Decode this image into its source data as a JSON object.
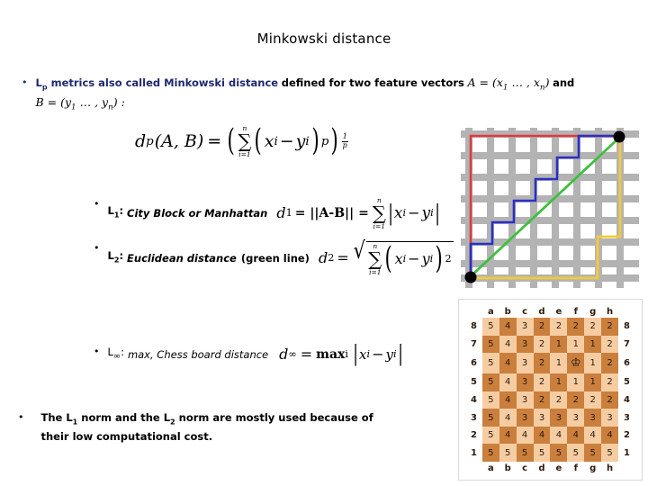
{
  "slide": {
    "title": "Minkowski distance"
  },
  "bullets": {
    "intro": {
      "marker": "•",
      "highlight": "L",
      "highlight_sub": "p",
      "highlight_rest": " metrics also called Minkowski distance",
      "plain": "defined for two feature vectors",
      "vector_a": "A = (x",
      "vector_a_sub1": "1",
      "vector_a_mid": " … , x",
      "vector_a_sub2": "n",
      "vector_a_end": ")",
      "and": "and",
      "vector_b": "B = (y",
      "vector_b_sub1": "1",
      "vector_b_mid": " … , y",
      "vector_b_sub2": "n",
      "vector_b_end": ") :"
    },
    "l1": {
      "marker": "•",
      "name": "L",
      "name_sub": "1",
      "colon": ":",
      "desc": "City Block or Manhattan",
      "d": "d",
      "d_sub": "1",
      "eq1": "= ||A-B|| =",
      "sum_upper": "n",
      "sum_lower": "i=1",
      "sum": "∑",
      "term_x": "x",
      "term_minus": "−",
      "term_y": "y",
      "term_sub": "i",
      "bar": "|"
    },
    "l2": {
      "marker": "•",
      "name": "L",
      "name_sub": "2",
      "colon": ":",
      "desc": "Euclidean distance",
      "note": "(green line)",
      "d": "d",
      "d_sub": "2",
      "eq": "=",
      "sum": "∑",
      "sum_upper": "n",
      "sum_lower": "i=1",
      "term_x": "x",
      "term_minus": "−",
      "term_y": "y",
      "term_sub": "i",
      "power": "2",
      "radical": "√"
    },
    "linf": {
      "marker": "•",
      "name": "L",
      "name_sub": "∞",
      "colon": ":",
      "desc": "max, Chess board distance",
      "d": "d",
      "d_sub": "∞",
      "eq": "=",
      "maxtext": "max",
      "max_sub": "i",
      "bar": "|",
      "term_x": "x",
      "term_minus": "−",
      "term_y": "y",
      "term_sub": "i"
    },
    "closing": {
      "marker": "•",
      "line1_a": "The  L",
      "line1_sub1": "1",
      "line1_b": " norm and the  L",
      "line1_sub2": "2",
      "line1_c": "  norm are mostly used because of",
      "line2": "their low computational cost."
    }
  },
  "formula_main": {
    "d": "d",
    "d_sub": "p",
    "args": "(A, B)",
    "eq": "=",
    "sum": "∑",
    "sum_upper": "n",
    "sum_lower": "i=1",
    "term_x": "x",
    "term_minus": "−",
    "term_y": "y",
    "term_sub": "i",
    "inner_power": "p",
    "outer_num": "1",
    "outer_den": "p"
  },
  "taxicab_figure": {
    "name": "taxicab-distance-grid",
    "colors": {
      "street": "#B3B3B3",
      "block": "#FFFFFF",
      "red_path": "#E0393E",
      "blue_path": "#2A2FC4",
      "yellow_path": "#F2CB3A",
      "green_line": "#3CC13C",
      "endpoint": "#000000"
    },
    "paths": [
      "red",
      "blue",
      "yellow",
      "green"
    ]
  },
  "chessboard": {
    "file_labels": [
      "a",
      "b",
      "c",
      "d",
      "e",
      "f",
      "g",
      "h"
    ],
    "rank_labels": [
      "8",
      "7",
      "6",
      "5",
      "4",
      "3",
      "2",
      "1"
    ],
    "king_square": "f6",
    "king_glyph": "♔",
    "colors": {
      "light": "#F6CDA2",
      "dark": "#CA7F3D"
    },
    "rows": [
      {
        "rank": "8",
        "values": [
          "5",
          "4",
          "3",
          "2",
          "2",
          "2",
          "2",
          "2"
        ]
      },
      {
        "rank": "7",
        "values": [
          "5",
          "4",
          "3",
          "2",
          "1",
          "1",
          "1",
          "2"
        ]
      },
      {
        "rank": "6",
        "values": [
          "5",
          "4",
          "3",
          "2",
          "1",
          "K",
          "1",
          "2"
        ]
      },
      {
        "rank": "5",
        "values": [
          "5",
          "4",
          "3",
          "2",
          "1",
          "1",
          "1",
          "2"
        ]
      },
      {
        "rank": "4",
        "values": [
          "5",
          "4",
          "3",
          "2",
          "2",
          "2",
          "2",
          "2"
        ]
      },
      {
        "rank": "3",
        "values": [
          "5",
          "4",
          "3",
          "3",
          "3",
          "3",
          "3",
          "3"
        ]
      },
      {
        "rank": "2",
        "values": [
          "5",
          "4",
          "4",
          "4",
          "4",
          "4",
          "4",
          "4"
        ]
      },
      {
        "rank": "1",
        "values": [
          "5",
          "5",
          "5",
          "5",
          "5",
          "5",
          "5",
          "5"
        ]
      }
    ]
  }
}
